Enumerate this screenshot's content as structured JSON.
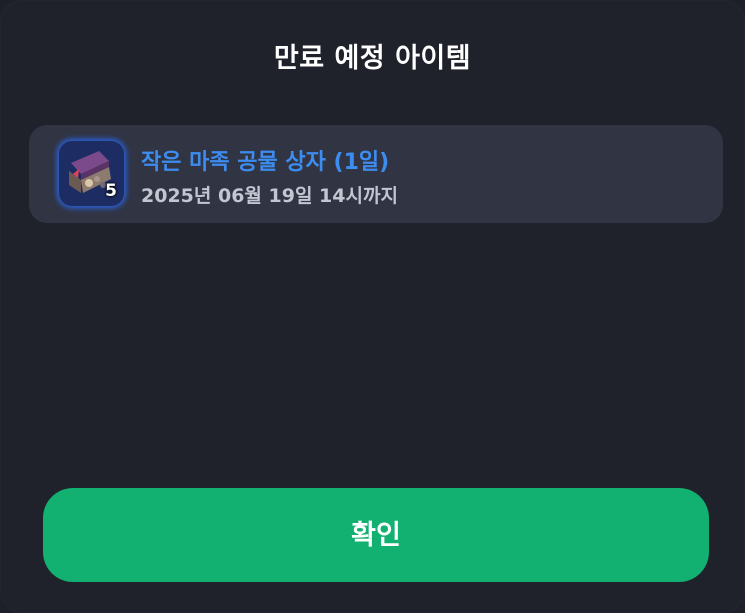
{
  "dialog": {
    "title": "만료 예정 아이템"
  },
  "items": [
    {
      "name": "작은 마족 공물 상자 (1일)",
      "expiry": "2025년 06월 19일 14시까지",
      "count": "5",
      "icon": "demon-tribute-chest-icon"
    }
  ],
  "footer": {
    "confirm_label": "확인"
  },
  "colors": {
    "background": "#1f212b",
    "card": "#313443",
    "item_name": "#3d8cf0",
    "confirm": "#12b071"
  }
}
